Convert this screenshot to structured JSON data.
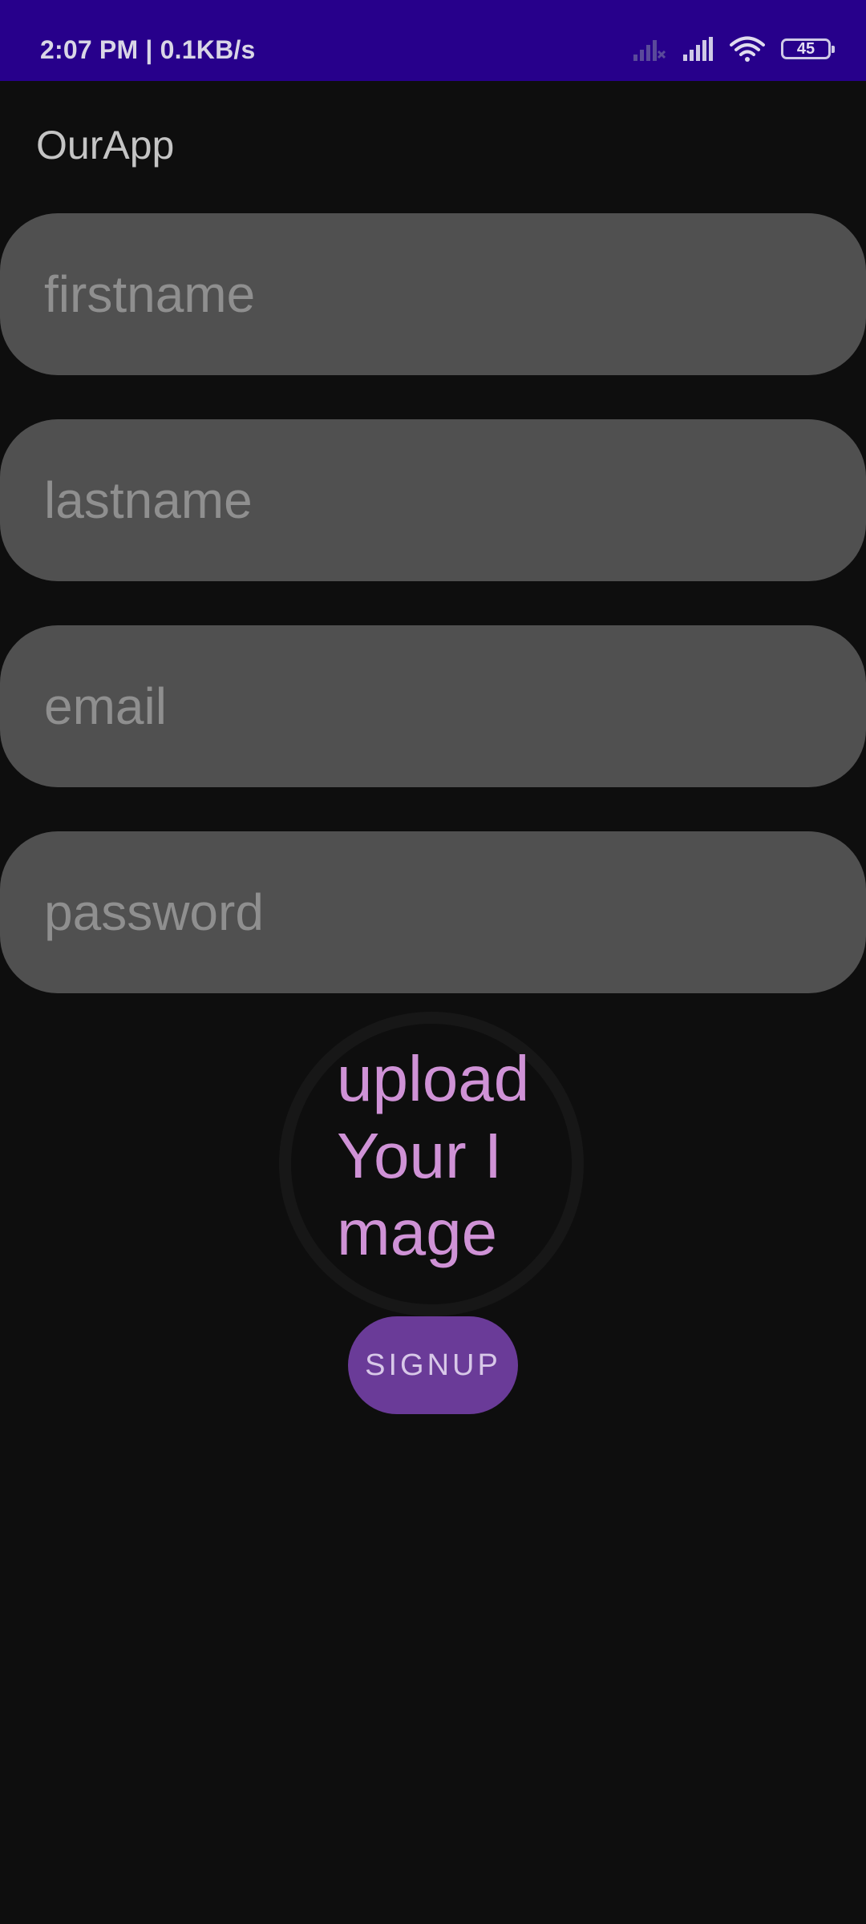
{
  "status_bar": {
    "time_speed": "2:07 PM | 0.1KB/s",
    "battery": "45",
    "icons": [
      "signal-off-icon",
      "signal-icon",
      "wifi-icon",
      "battery-icon"
    ],
    "color": "#27008b"
  },
  "app": {
    "title": "OurApp"
  },
  "form": {
    "firstname_placeholder": "firstname",
    "lastname_placeholder": "lastname",
    "email_placeholder": "email",
    "password_placeholder": "password"
  },
  "upload": {
    "label": "upload Your Image"
  },
  "signup": {
    "label": "SIGNUP",
    "color": "#6a3b98"
  }
}
